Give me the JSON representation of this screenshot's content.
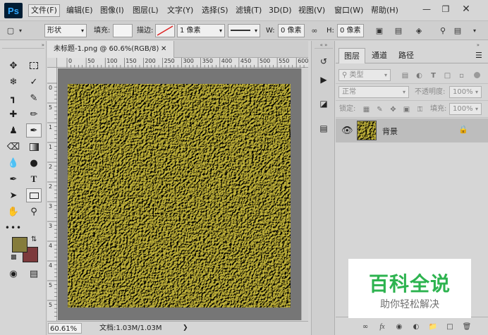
{
  "app": {
    "logo": "Ps"
  },
  "menubar": {
    "items": [
      "文件(F)",
      "编辑(E)",
      "图像(I)",
      "图层(L)",
      "文字(Y)",
      "选择(S)",
      "滤镜(T)",
      "3D(D)",
      "视图(V)",
      "窗口(W)",
      "帮助(H)"
    ],
    "active_index": 0
  },
  "options": {
    "shape_mode": "形状",
    "fill_label": "填充:",
    "stroke_label": "描边:",
    "stroke_width": "1 像素",
    "w_label": "W:",
    "w_value": "0 像素",
    "h_label": "H:",
    "h_value": "0 像素"
  },
  "document": {
    "tab_title": "未标题-1.png @ 60.6%(RGB/8)",
    "ruler_top": [
      "0",
      "50",
      "100",
      "150",
      "200",
      "250",
      "300",
      "350",
      "400",
      "450",
      "500",
      "550",
      "600"
    ],
    "ruler_left": [
      "0",
      "5",
      "1",
      "1",
      "2",
      "2",
      "3",
      "3",
      "4",
      "4",
      "5",
      "5"
    ],
    "zoom": "60.61%",
    "doc_info": "文档:1.03M/1.03M"
  },
  "layers": {
    "tabs": [
      "图层",
      "通道",
      "路径"
    ],
    "active_tab": 0,
    "filter_placeholder": "类型",
    "blend_mode": "正常",
    "opacity_label": "不透明度:",
    "opacity_value": "100%",
    "lock_label": "锁定:",
    "fill_label": "填充:",
    "fill_value": "100%",
    "layer_list": [
      {
        "name": "背景",
        "visible": true,
        "locked": true
      }
    ]
  },
  "colors": {
    "foreground": "#857c3c",
    "background": "#7d3a3c",
    "texture_base": "#c2b64a",
    "workspace": "#767676"
  },
  "watermark": {
    "title": "百科全说",
    "subtitle": "助你轻松解决"
  }
}
